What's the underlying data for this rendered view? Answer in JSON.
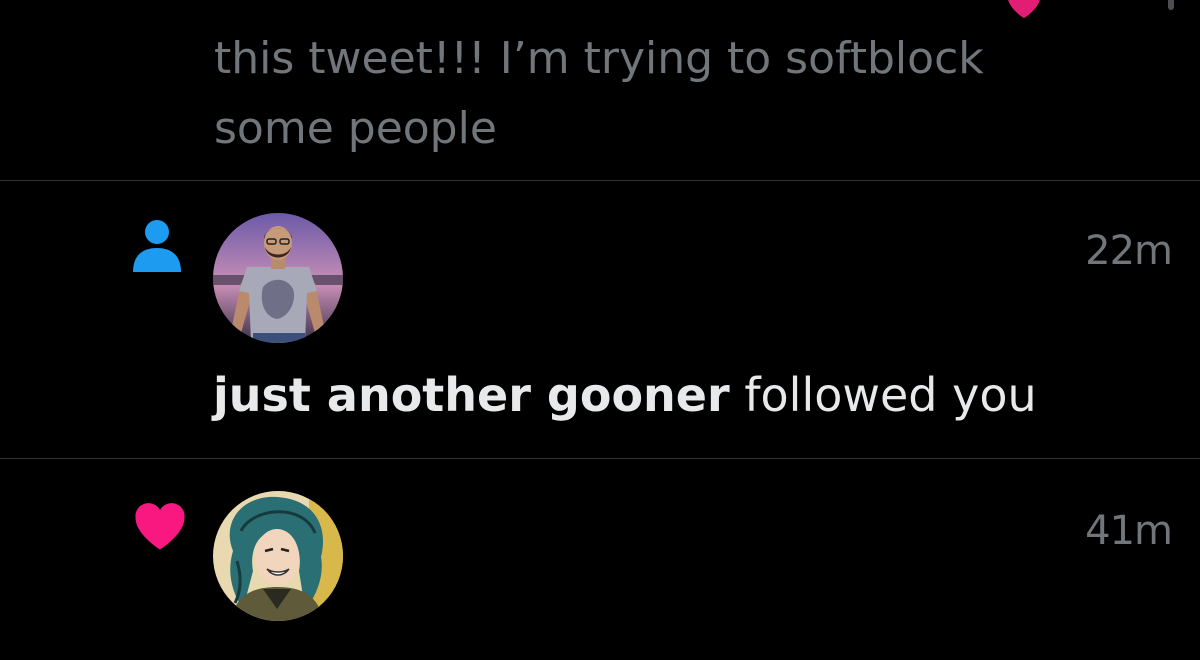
{
  "colors": {
    "background": "#000000",
    "divider": "#2f3336",
    "muted_text": "#71767b",
    "primary_text": "#e7e9ea",
    "follow_icon": "#1d9bf0",
    "like_icon": "#f91880"
  },
  "previous_notification": {
    "quoted_tweet_lines": [
      "this tweet!!! I’m trying to softblock",
      "some people"
    ]
  },
  "notifications": [
    {
      "type": "follow",
      "icon": "person-icon",
      "timestamp": "22m",
      "user_name": "just another gooner",
      "action_text": " followed you"
    },
    {
      "type": "like",
      "icon": "heart-icon",
      "timestamp": "41m"
    }
  ]
}
